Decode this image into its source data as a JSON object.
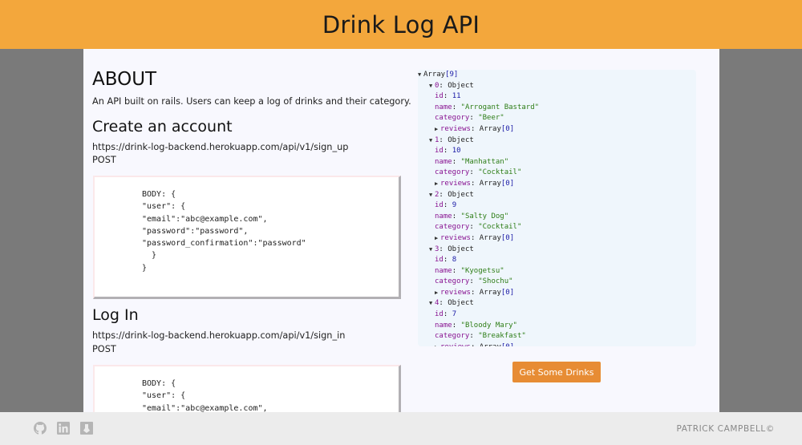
{
  "header": {
    "title": "Drink Log API"
  },
  "about": {
    "heading": "ABOUT",
    "text": "An API built on rails. Users can keep a log of drinks and their category."
  },
  "create_account": {
    "heading": "Create an account",
    "url": "https://drink-log-backend.herokuapp.com/api/v1/sign_up",
    "method": "POST",
    "body_lines": [
      "BODY: {",
      "\"user\": {",
      "\"email\":\"abc@example.com\",",
      "\"password\":\"password\",",
      "\"password_confirmation\":\"password\"",
      "  }",
      "}"
    ]
  },
  "login": {
    "heading": "Log In",
    "url": "https://drink-log-backend.herokuapp.com/api/v1/sign_in",
    "method": "POST",
    "body_lines": [
      "BODY: {",
      "\"user\": {",
      "\"email\":\"abc@example.com\","
    ]
  },
  "json_view": {
    "root_label": "Array",
    "root_count": "[9]",
    "object_label": "Object",
    "reviews_type": "Array",
    "reviews_count": "[0]",
    "items": [
      {
        "index": "0",
        "id": "11",
        "name": "\"Arrogant Bastard\"",
        "category": "\"Beer\""
      },
      {
        "index": "1",
        "id": "10",
        "name": "\"Manhattan\"",
        "category": "\"Cocktail\""
      },
      {
        "index": "2",
        "id": "9",
        "name": "\"Salty Dog\"",
        "category": "\"Cocktail\""
      },
      {
        "index": "3",
        "id": "8",
        "name": "\"Kyogetsu\"",
        "category": "\"Shochu\""
      },
      {
        "index": "4",
        "id": "7",
        "name": "\"Bloody Mary\"",
        "category": "\"Breakfast\""
      }
    ]
  },
  "button": {
    "label": "Get Some Drinks"
  },
  "footer": {
    "copyright": "PATRICK CAMPBELL©",
    "icons": [
      "github-icon",
      "linkedin-icon",
      "portfolio-icon"
    ]
  },
  "colors": {
    "header_bg": "#f3a73c",
    "button_bg": "#e78c34",
    "page_bg": "#7a7a7a",
    "content_bg": "#f8f8fe",
    "json_bg": "#eff6fc"
  }
}
